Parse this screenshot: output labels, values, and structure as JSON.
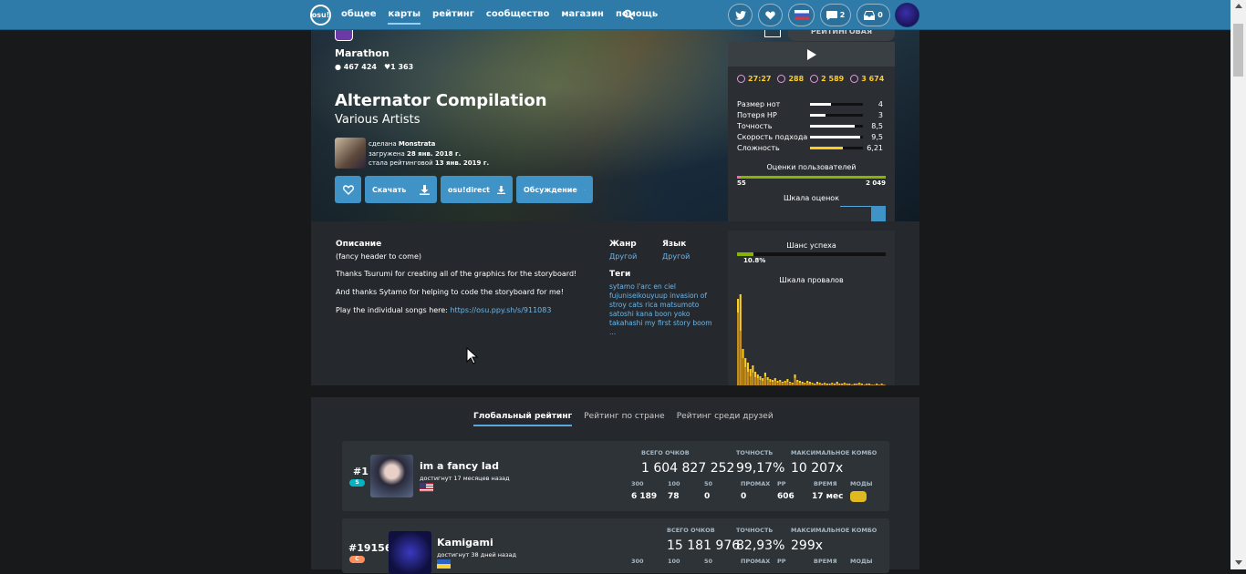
{
  "nav": {
    "logo": "osu!",
    "links": [
      "общее",
      "карты",
      "рейтинг",
      "сообщество",
      "магазин",
      "помощь"
    ],
    "active": "карты",
    "messages_count": "2",
    "notifications_count": "0"
  },
  "header": {
    "rank_status": "РЕЙТИНГОВАЯ",
    "difficulty": "Marathon",
    "playcount": "467 424",
    "favourites": "1 363",
    "title": "Alternator Compilation",
    "artist": "Various Artists",
    "mapped_by_label": "сделана",
    "mapper": "Monstrata",
    "submitted_label": "загружена",
    "submitted_date": "28 янв. 2018 г.",
    "ranked_label": "стала рейтинговой",
    "ranked_date": "13 янв. 2019 г.",
    "buttons": {
      "download": "Скачать",
      "osudirect": "osu!direct",
      "discussion": "Обсуждение"
    }
  },
  "map_stats": {
    "length": "27:27",
    "bpm": "288",
    "circles": "2 589",
    "sliders": "3 674"
  },
  "attributes": [
    {
      "label": "Размер нот",
      "value": "4",
      "fill": 0.4,
      "yellow": false
    },
    {
      "label": "Потеря HP",
      "value": "3",
      "fill": 0.3,
      "yellow": false
    },
    {
      "label": "Точность",
      "value": "8,5",
      "fill": 0.85,
      "yellow": false
    },
    {
      "label": "Скорость подхода",
      "value": "9,5",
      "fill": 0.95,
      "yellow": false
    },
    {
      "label": "Сложность",
      "value": "6,21",
      "fill": 0.621,
      "yellow": true
    }
  ],
  "rating": {
    "title": "Оценки пользователей",
    "negative": "55",
    "positive": "2 049",
    "spread_title": "Шкала оценок"
  },
  "description": {
    "title": "Описание",
    "lines": [
      "(fancy header to come)",
      "Thanks Tsurumi for creating all of the graphics for the storyboard!",
      "And thanks Sytamo for helping to code the storyboard for me!"
    ],
    "link_prefix": "Play the individual songs here: ",
    "link": "https://osu.ppy.sh/s/911083"
  },
  "meta": {
    "genre_label": "Жанр",
    "genre": "Другой",
    "language_label": "Язык",
    "language": "Другой",
    "tags_label": "Теги",
    "tags": "sytamo l'arc en ciel fujuniseikouyuup invasion of stroy cats rica matsumoto satoshi kana boon yoko takahashi my first story boom ..."
  },
  "success": {
    "title": "Шанс успеха",
    "rate": "10.8%",
    "rate_value": 0.108,
    "fail_title": "Шкала провалов"
  },
  "fail_chart": {
    "values": [
      95,
      100,
      40,
      30,
      25,
      18,
      22,
      15,
      12,
      10,
      8,
      14,
      9,
      7,
      6,
      8,
      5,
      6,
      4,
      5,
      7,
      4,
      3,
      12,
      6,
      5,
      4,
      3,
      5,
      4,
      3,
      2,
      4,
      3,
      2,
      3,
      2,
      2,
      3,
      2,
      4,
      2,
      2,
      3,
      2,
      2,
      1,
      2,
      2,
      3,
      2,
      1,
      2,
      2,
      1,
      1,
      2,
      1,
      2,
      1
    ],
    "exits": [
      80,
      60,
      30,
      20,
      15,
      10,
      14,
      9,
      8,
      6,
      5,
      10,
      6,
      4,
      4,
      5,
      3,
      4,
      3,
      3,
      4,
      3,
      2,
      8,
      4,
      3,
      2,
      2,
      3,
      2,
      2,
      1,
      2,
      2,
      1,
      2,
      1,
      1,
      2,
      1,
      2,
      1,
      1,
      2,
      1,
      1,
      1,
      1,
      1,
      2,
      1,
      1,
      1,
      1,
      1,
      1,
      1,
      1,
      1,
      1
    ]
  },
  "leaderboard": {
    "tabs": [
      "Глобальный рейтинг",
      "Рейтинг по стране",
      "Рейтинг среди друзей"
    ],
    "active_tab": "Глобальный рейтинг",
    "headers": {
      "total": "ВСЕГО ОЧКОВ",
      "accuracy": "ТОЧНОСТЬ",
      "combo": "МАКСИМАЛЬНОЕ КОМБО",
      "c300": "300",
      "c100": "100",
      "c50": "50",
      "miss": "ПРОМАХ",
      "pp": "PP",
      "time": "ВРЕМЯ",
      "mods": "МОДЫ"
    },
    "scores": [
      {
        "rank": "#1",
        "grade": "S",
        "user": "im a fancy lad",
        "achieved": "достигнут 17 месяцев назад",
        "total": "1 604 827 252",
        "accuracy": "99,17%",
        "combo": "10 207x",
        "c300": "6 189",
        "c100": "78",
        "c50": "0",
        "miss": "0",
        "pp": "606",
        "time": "17 мес",
        "flag": "us"
      },
      {
        "rank": "#19156",
        "grade": "C",
        "user": "Kamigami",
        "achieved": "достигнут 38 дней назад",
        "total": "15 181 976",
        "accuracy": "82,93%",
        "combo": "299x",
        "flag": "ua"
      }
    ]
  },
  "colors": {
    "nav": "#2e7aa8",
    "accent": "#3f93c7",
    "yellow": "#ffcc22",
    "green": "#88b300"
  }
}
